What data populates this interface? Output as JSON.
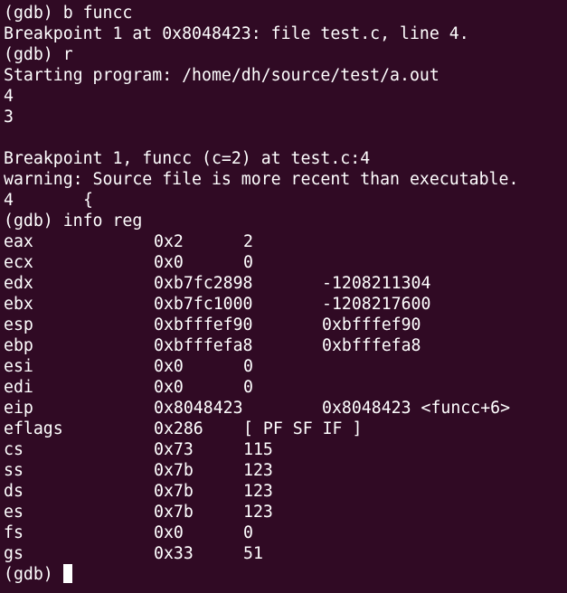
{
  "terminal": {
    "background": "#300a24",
    "foreground": "#ffffff",
    "lines_before_regs": [
      "(gdb) b funcc",
      "Breakpoint 1 at 0x8048423: file test.c, line 4.",
      "(gdb) r",
      "Starting program: /home/dh/source/test/a.out",
      "4",
      "3",
      "",
      "Breakpoint 1, funcc (c=2) at test.c:4",
      "warning: Source file is more recent than executable.",
      "4\t    {",
      "(gdb) info reg"
    ],
    "registers": [
      {
        "name": "eax",
        "hex": "0x2",
        "natural": "2"
      },
      {
        "name": "ecx",
        "hex": "0x0",
        "natural": "0"
      },
      {
        "name": "edx",
        "hex": "0xb7fc2898",
        "natural": "-1208211304"
      },
      {
        "name": "ebx",
        "hex": "0xb7fc1000",
        "natural": "-1208217600"
      },
      {
        "name": "esp",
        "hex": "0xbfffef90",
        "natural": "0xbfffef90"
      },
      {
        "name": "ebp",
        "hex": "0xbfffefa8",
        "natural": "0xbfffefa8"
      },
      {
        "name": "esi",
        "hex": "0x0",
        "natural": "0"
      },
      {
        "name": "edi",
        "hex": "0x0",
        "natural": "0"
      },
      {
        "name": "eip",
        "hex": "0x8048423",
        "natural": "0x8048423 <funcc+6>"
      },
      {
        "name": "eflags",
        "hex": "0x286",
        "natural": "[ PF SF IF ]"
      },
      {
        "name": "cs",
        "hex": "0x73",
        "natural": "115"
      },
      {
        "name": "ss",
        "hex": "0x7b",
        "natural": "123"
      },
      {
        "name": "ds",
        "hex": "0x7b",
        "natural": "123"
      },
      {
        "name": "es",
        "hex": "0x7b",
        "natural": "123"
      },
      {
        "name": "fs",
        "hex": "0x0",
        "natural": "0"
      },
      {
        "name": "gs",
        "hex": "0x33",
        "natural": "51"
      }
    ],
    "prompt": "(gdb) "
  }
}
